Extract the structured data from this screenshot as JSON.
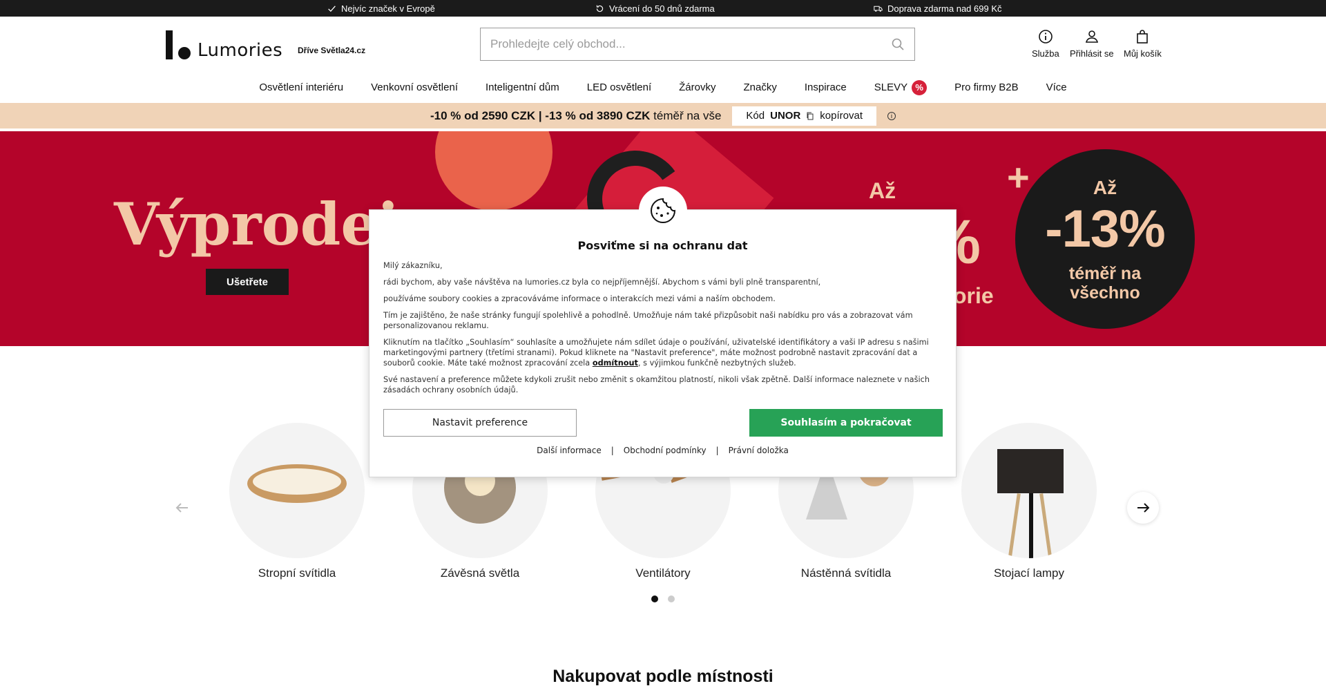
{
  "topbar": {
    "items": [
      {
        "icon": "check-icon",
        "text": "Nejvíc značek v Evropě"
      },
      {
        "icon": "return-icon",
        "text": "Vrácení do 50 dnů zdarma"
      },
      {
        "icon": "truck-icon",
        "text": "Doprava zdarma nad 699 Kč"
      }
    ]
  },
  "header": {
    "logo_text": "Lumories",
    "logo_sub": "Dříve Světla24.cz",
    "search_placeholder": "Prohledejte celý obchod...",
    "icons": [
      {
        "icon": "info-icon",
        "label": "Služba"
      },
      {
        "icon": "user-icon",
        "label": "Přihlásit se"
      },
      {
        "icon": "bag-icon",
        "label": "Můj košík"
      }
    ]
  },
  "nav": {
    "items": [
      "Osvětlení interiéru",
      "Venkovní osvětlení",
      "Inteligentní dům",
      "LED osvětlení",
      "Žárovky",
      "Značky",
      "Inspirace",
      "SLEVY",
      "Pro firmy B2B",
      "Více"
    ],
    "badge": "%"
  },
  "promo": {
    "text_bold": "-10 % od 2590 CZK | -13 % od 3890 CZK",
    "text_rest": "téměř na vše",
    "code_label": "Kód",
    "code": "UNOR",
    "copy_label": "kopírovat"
  },
  "hero": {
    "title": "Výprodej",
    "button": "Ušetřete",
    "az": "Až",
    "big": "%",
    "orie": "orie",
    "badge_plus": "+",
    "badge_az": "Až",
    "badge_pct": "-13%",
    "badge_line1": "téměř na",
    "badge_line2": "všechno"
  },
  "cookie": {
    "title": "Posviťme si na ochranu dat",
    "p1": "Milý zákazníku,",
    "p2": "rádi bychom, aby vaše návštěva na lumories.cz byla co nejpříjemnější. Abychom s vámi byli plně transparentní,",
    "p3": "používáme soubory cookies a zpracováváme informace o interakcích mezi vámi a naším obchodem.",
    "p4": "Tím je zajištěno, že naše stránky fungují spolehlivě a pohodlně. Umožňuje nám také přizpůsobit naši nabídku pro vás a zobrazovat vám personalizovanou reklamu.",
    "p5a": "Kliknutím na tlačítko „Souhlasím“ souhlasíte a umožňujete nám sdílet údaje o používání, uživatelské identifikátory a vaši IP adresu s našimi marketingovými partnery (třetími stranami). Pokud kliknete na \"Nastavit preference\", máte možnost podrobně nastavit zpracování dat a souborů cookie. Máte také možnost zpracování zcela",
    "p5link": "odmítnout",
    "p5b": ", s výjimkou funkčně nezbytných služeb.",
    "p6": "Své nastavení a preference můžete kdykoli zrušit nebo změnit s okamžitou platností, nikoli však zpětně. Další informace naleznete v našich zásadách ochrany osobních údajů.",
    "btn_pref": "Nastavit preference",
    "btn_agree": "Souhlasím a pokračovat",
    "links": [
      "Další informace",
      "Obchodní podmínky",
      "Právní doložka"
    ],
    "sep": "|"
  },
  "categories": {
    "items": [
      "Stropní svítidla",
      "Závěsná světla",
      "Ventilátory",
      "Nástěnná svítidla",
      "Stojací lampy"
    ]
  },
  "section_title": "Nakupovat podle místnosti",
  "colors": {
    "accent_green": "#27a256",
    "hero_red": "#b4042a",
    "promo_bg": "#f0d3b7",
    "sale_badge": "#d6213a"
  }
}
